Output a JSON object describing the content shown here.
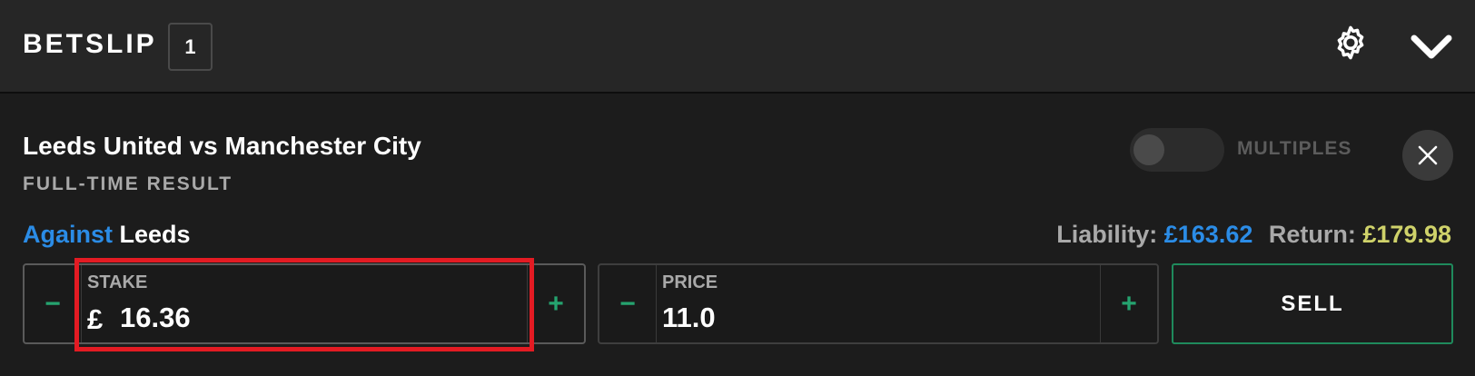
{
  "header": {
    "title": "BETSLIP",
    "count": "1",
    "settings_icon": "gear-icon",
    "collapse_icon": "chevron-down-icon"
  },
  "bet": {
    "match": "Leeds United vs Manchester City",
    "market": "FULL-TIME RESULT",
    "multiples_label": "MULTIPLES",
    "multiples_on": false,
    "close_icon": "close-icon",
    "side": "Against",
    "selection": "Leeds",
    "liability_label": "Liability:",
    "liability_value": "£163.62",
    "return_label": "Return:",
    "return_value": "£179.98"
  },
  "stake": {
    "label": "STAKE",
    "currency": "£",
    "value": "16.36",
    "minus": "−",
    "plus": "+"
  },
  "price": {
    "label": "PRICE",
    "value": "11.0",
    "minus": "−",
    "plus": "+"
  },
  "action": {
    "label": "SELL"
  },
  "colors": {
    "header_bg": "#262626",
    "body_bg": "#1c1c1c",
    "against_blue": "#2b8ce6",
    "return_yellow": "#cfd26a",
    "accent_green": "#25a36f",
    "highlight_red": "#e31b23"
  }
}
